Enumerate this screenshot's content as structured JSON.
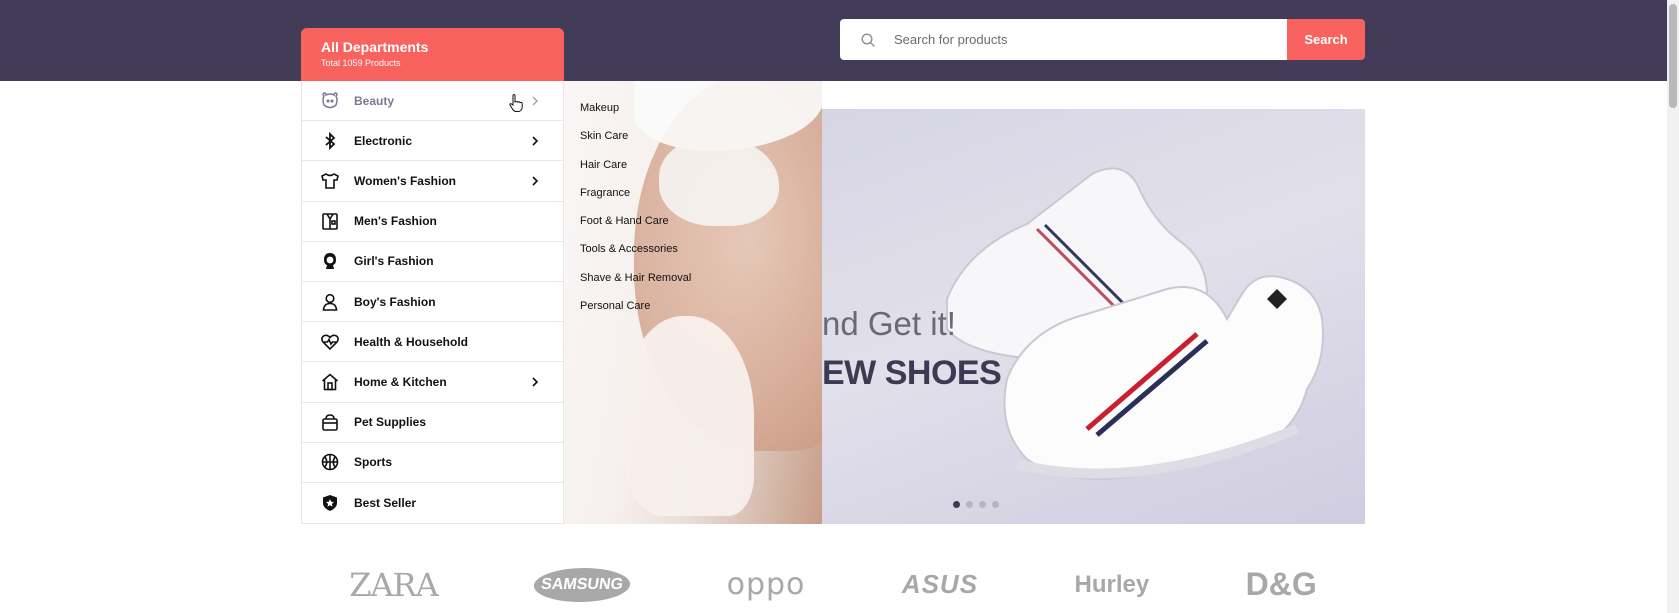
{
  "header": {
    "departments_title": "All Departments",
    "departments_subtitle": "Total 1059 Products",
    "search_placeholder": "Search for products",
    "search_button": "Search"
  },
  "menu": [
    {
      "label": "Beauty",
      "icon": "face-icon",
      "has_submenu": true,
      "active": true
    },
    {
      "label": "Electronic",
      "icon": "bluetooth-icon",
      "has_submenu": true
    },
    {
      "label": "Women's Fashion",
      "icon": "dress-icon",
      "has_submenu": true
    },
    {
      "label": "Men's Fashion",
      "icon": "suit-icon",
      "has_submenu": false
    },
    {
      "label": "Girl's Fashion",
      "icon": "girl-icon",
      "has_submenu": false
    },
    {
      "label": "Boy's Fashion",
      "icon": "person-icon",
      "has_submenu": false
    },
    {
      "label": "Health & Household",
      "icon": "heart-pulse-icon",
      "has_submenu": false
    },
    {
      "label": "Home & Kitchen",
      "icon": "home-icon",
      "has_submenu": true
    },
    {
      "label": "Pet Supplies",
      "icon": "pet-carrier-icon",
      "has_submenu": false
    },
    {
      "label": "Sports",
      "icon": "basketball-icon",
      "has_submenu": false
    },
    {
      "label": "Best Seller",
      "icon": "star-shield-icon",
      "has_submenu": false
    }
  ],
  "submenu": [
    "Makeup",
    "Skin Care",
    "Hair Care",
    "Fragrance",
    "Foot & Hand Care",
    "Tools & Accessories",
    "Shave & Hair Removal",
    "Personal Care"
  ],
  "banner": {
    "tagline": "nd Get it!",
    "headline": "EW SHOES",
    "slides": 4,
    "active_slide": 1
  },
  "brands": [
    "ZARA",
    "SAMSUNG",
    "oppo",
    "ASUS",
    "Hurley",
    "D&G"
  ],
  "colors": {
    "topbar": "#423c58",
    "accent": "#f9635f"
  }
}
